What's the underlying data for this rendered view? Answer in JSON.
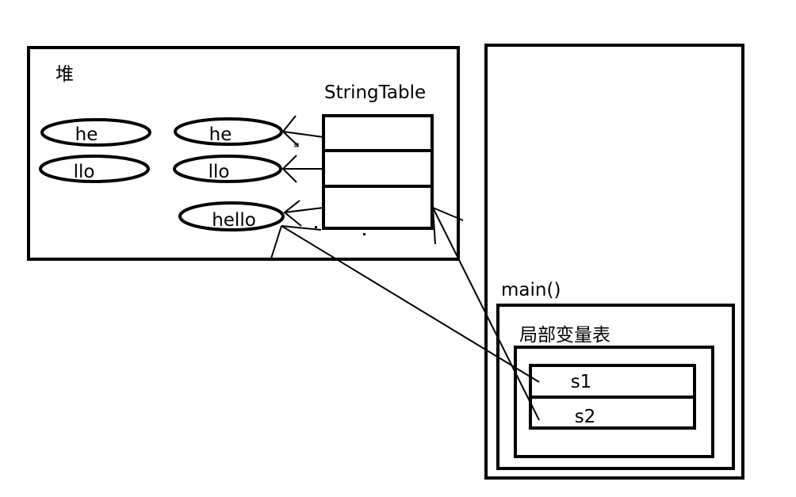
{
  "heap": {
    "title": "堆",
    "objects": [
      {
        "label": "he"
      },
      {
        "label": "llo"
      },
      {
        "label": "he"
      },
      {
        "label": "llo"
      },
      {
        "label": "hello"
      }
    ]
  },
  "string_table": {
    "title": "StringTable",
    "slot_count": 3
  },
  "stack": {
    "frame_title": "main()",
    "locals_title": "局部变量表",
    "slots": [
      {
        "label": "s1"
      },
      {
        "label": "s2"
      }
    ]
  }
}
